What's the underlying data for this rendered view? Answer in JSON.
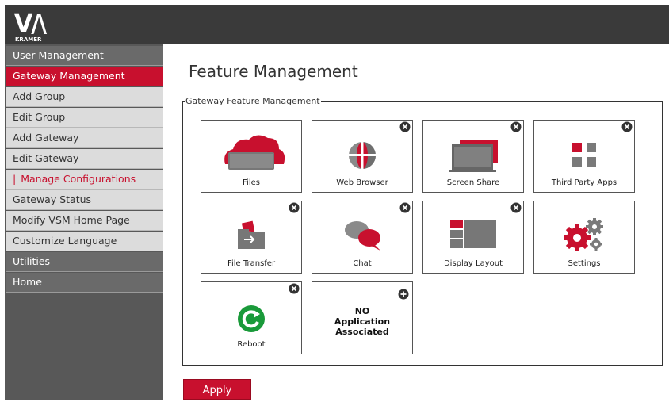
{
  "brand": {
    "logo_text": "V/A",
    "logo_subtext": "KRAMER",
    "accent_color": "#c8102e",
    "topbar_color": "#3a3a3a"
  },
  "sidebar": {
    "items": [
      {
        "label": "User Management",
        "state": "section"
      },
      {
        "label": "Gateway Management",
        "state": "active"
      },
      {
        "label": "Add Group",
        "state": "sub"
      },
      {
        "label": "Edit Group",
        "state": "sub"
      },
      {
        "label": "Add Gateway",
        "state": "sub"
      },
      {
        "label": "Edit Gateway",
        "state": "sub"
      },
      {
        "label": "Manage Configurations",
        "state": "sub-active",
        "prefix": "|"
      },
      {
        "label": "Gateway Status",
        "state": "sub"
      },
      {
        "label": "Modify VSM Home Page",
        "state": "sub"
      },
      {
        "label": "Customize Language",
        "state": "sub"
      },
      {
        "label": "Utilities",
        "state": "section"
      },
      {
        "label": "Home",
        "state": "section"
      }
    ]
  },
  "main": {
    "title": "Feature Management",
    "fieldset_legend": "Gateway Feature Management",
    "tiles": [
      {
        "label": "Files",
        "icon": "cloud-folder-icon",
        "badge": "none"
      },
      {
        "label": "Web Browser",
        "icon": "globe-icon",
        "badge": "remove"
      },
      {
        "label": "Screen Share",
        "icon": "screen-share-icon",
        "badge": "remove"
      },
      {
        "label": "Third Party Apps",
        "icon": "app-grid-icon",
        "badge": "remove"
      },
      {
        "label": "File Transfer",
        "icon": "file-transfer-icon",
        "badge": "remove"
      },
      {
        "label": "Chat",
        "icon": "chat-bubbles-icon",
        "badge": "remove"
      },
      {
        "label": "Display Layout",
        "icon": "display-layout-icon",
        "badge": "remove"
      },
      {
        "label": "Settings",
        "icon": "gears-icon",
        "badge": "none"
      },
      {
        "label": "Reboot",
        "icon": "reboot-icon",
        "badge": "remove"
      },
      {
        "label": "NO Application Associated",
        "lines": [
          "NO",
          "Application",
          "Associated"
        ],
        "icon": "none",
        "badge": "add"
      }
    ],
    "apply_label": "Apply"
  }
}
